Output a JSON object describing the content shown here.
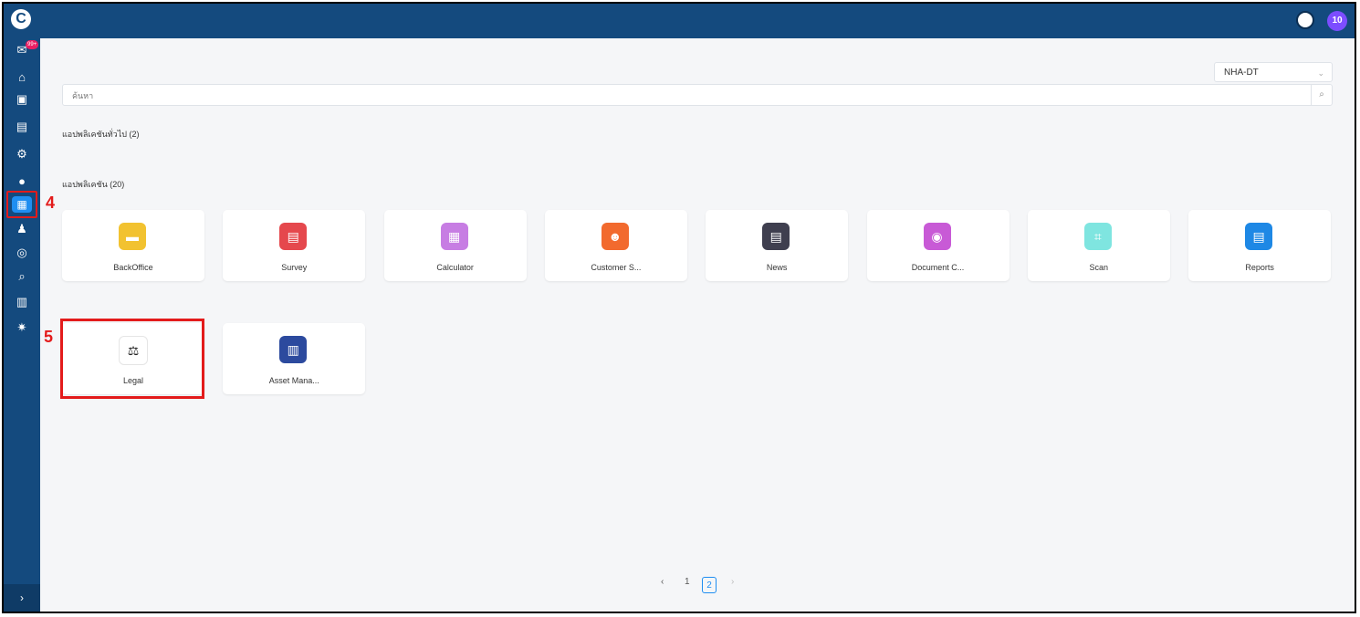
{
  "header": {
    "avatar_text": "10",
    "logo_text": "C"
  },
  "sidebar": {
    "badge": "99+",
    "items": [
      {
        "icon": "mail-icon",
        "glyph": "✉"
      },
      {
        "icon": "home-icon",
        "glyph": "⌂"
      },
      {
        "icon": "cards-icon",
        "glyph": "▣"
      },
      {
        "icon": "document-icon",
        "glyph": "▤"
      },
      {
        "icon": "settings-icon",
        "glyph": "⚙"
      },
      {
        "icon": "user-icon",
        "glyph": "●"
      },
      {
        "icon": "apps-icon",
        "glyph": "▦"
      },
      {
        "icon": "team-icon",
        "glyph": "♟"
      },
      {
        "icon": "package-icon",
        "glyph": "◎"
      },
      {
        "icon": "search-icon",
        "glyph": "⌕"
      },
      {
        "icon": "chart-icon",
        "glyph": "▥"
      },
      {
        "icon": "gears-icon",
        "glyph": "✷"
      }
    ],
    "expand_glyph": "›"
  },
  "annotations": {
    "step4": "4",
    "step5": "5"
  },
  "org_select": {
    "value": "NHA-DT",
    "chevron": "⌄"
  },
  "search": {
    "placeholder": "ค้นหา",
    "icon_glyph": "⌕"
  },
  "sections": {
    "general": "แอปพลิเคชันทั่วไป  (2)",
    "apps": "แอปพลิเคชัน  (20)"
  },
  "apps_row1": [
    {
      "label": "BackOffice",
      "color": "#f2c230",
      "glyph": "▬"
    },
    {
      "label": "Survey",
      "color": "#e5484d",
      "glyph": "▤"
    },
    {
      "label": "Calculator",
      "color": "#c77de3",
      "glyph": "▦"
    },
    {
      "label": "Customer S...",
      "color": "#f26a2e",
      "glyph": "☻"
    },
    {
      "label": "News",
      "color": "#3f3f4f",
      "glyph": "▤"
    },
    {
      "label": "Document C...",
      "color": "#c85ad6",
      "glyph": "◉"
    },
    {
      "label": "Scan",
      "color": "#7fe5e0",
      "glyph": "⌗"
    },
    {
      "label": "Reports",
      "color": "#1e88e5",
      "glyph": "▤"
    }
  ],
  "apps_row2": [
    {
      "label": "Legal",
      "color": "#ffffff",
      "glyph": "⚖"
    },
    {
      "label": "Asset Mana...",
      "color": "#2c4a9e",
      "glyph": "▥"
    }
  ],
  "pagination": {
    "prev": "‹",
    "page1": "1",
    "page2": "2",
    "next": "›"
  }
}
